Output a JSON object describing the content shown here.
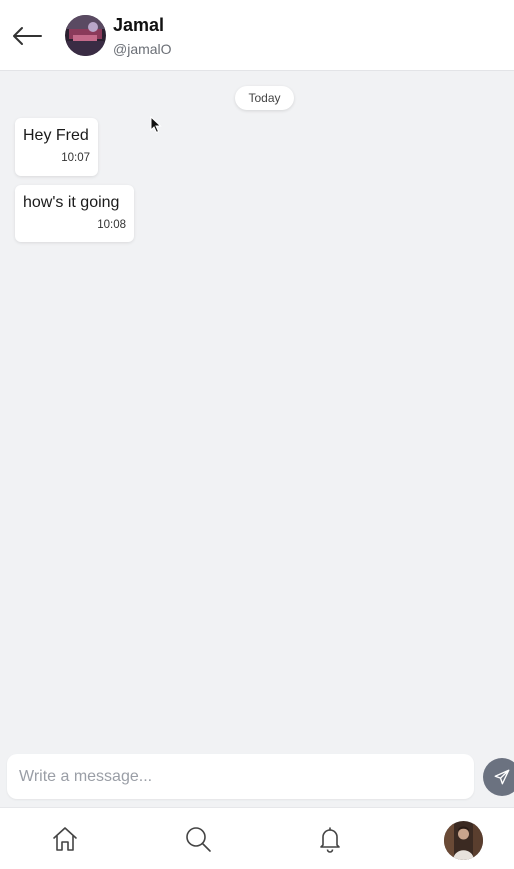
{
  "header": {
    "name": "Jamal",
    "handle": "@jamalO",
    "back_icon": "arrow-left-icon",
    "avatar_icon": "contact-avatar"
  },
  "date_divider": "Today",
  "messages": [
    {
      "text": "Hey Fred",
      "time": "10:07"
    },
    {
      "text": "how's it going",
      "time": "10:08"
    }
  ],
  "composer": {
    "placeholder": "Write a message...",
    "value": "",
    "send_icon": "paper-plane-icon"
  },
  "bottom_nav": {
    "items": [
      {
        "icon": "home-icon"
      },
      {
        "icon": "search-icon"
      },
      {
        "icon": "bell-icon"
      },
      {
        "icon": "profile-avatar"
      }
    ]
  },
  "colors": {
    "background": "#f1f2f4",
    "surface": "#ffffff",
    "send_button": "#6b7280",
    "icon_stroke": "#444444"
  }
}
